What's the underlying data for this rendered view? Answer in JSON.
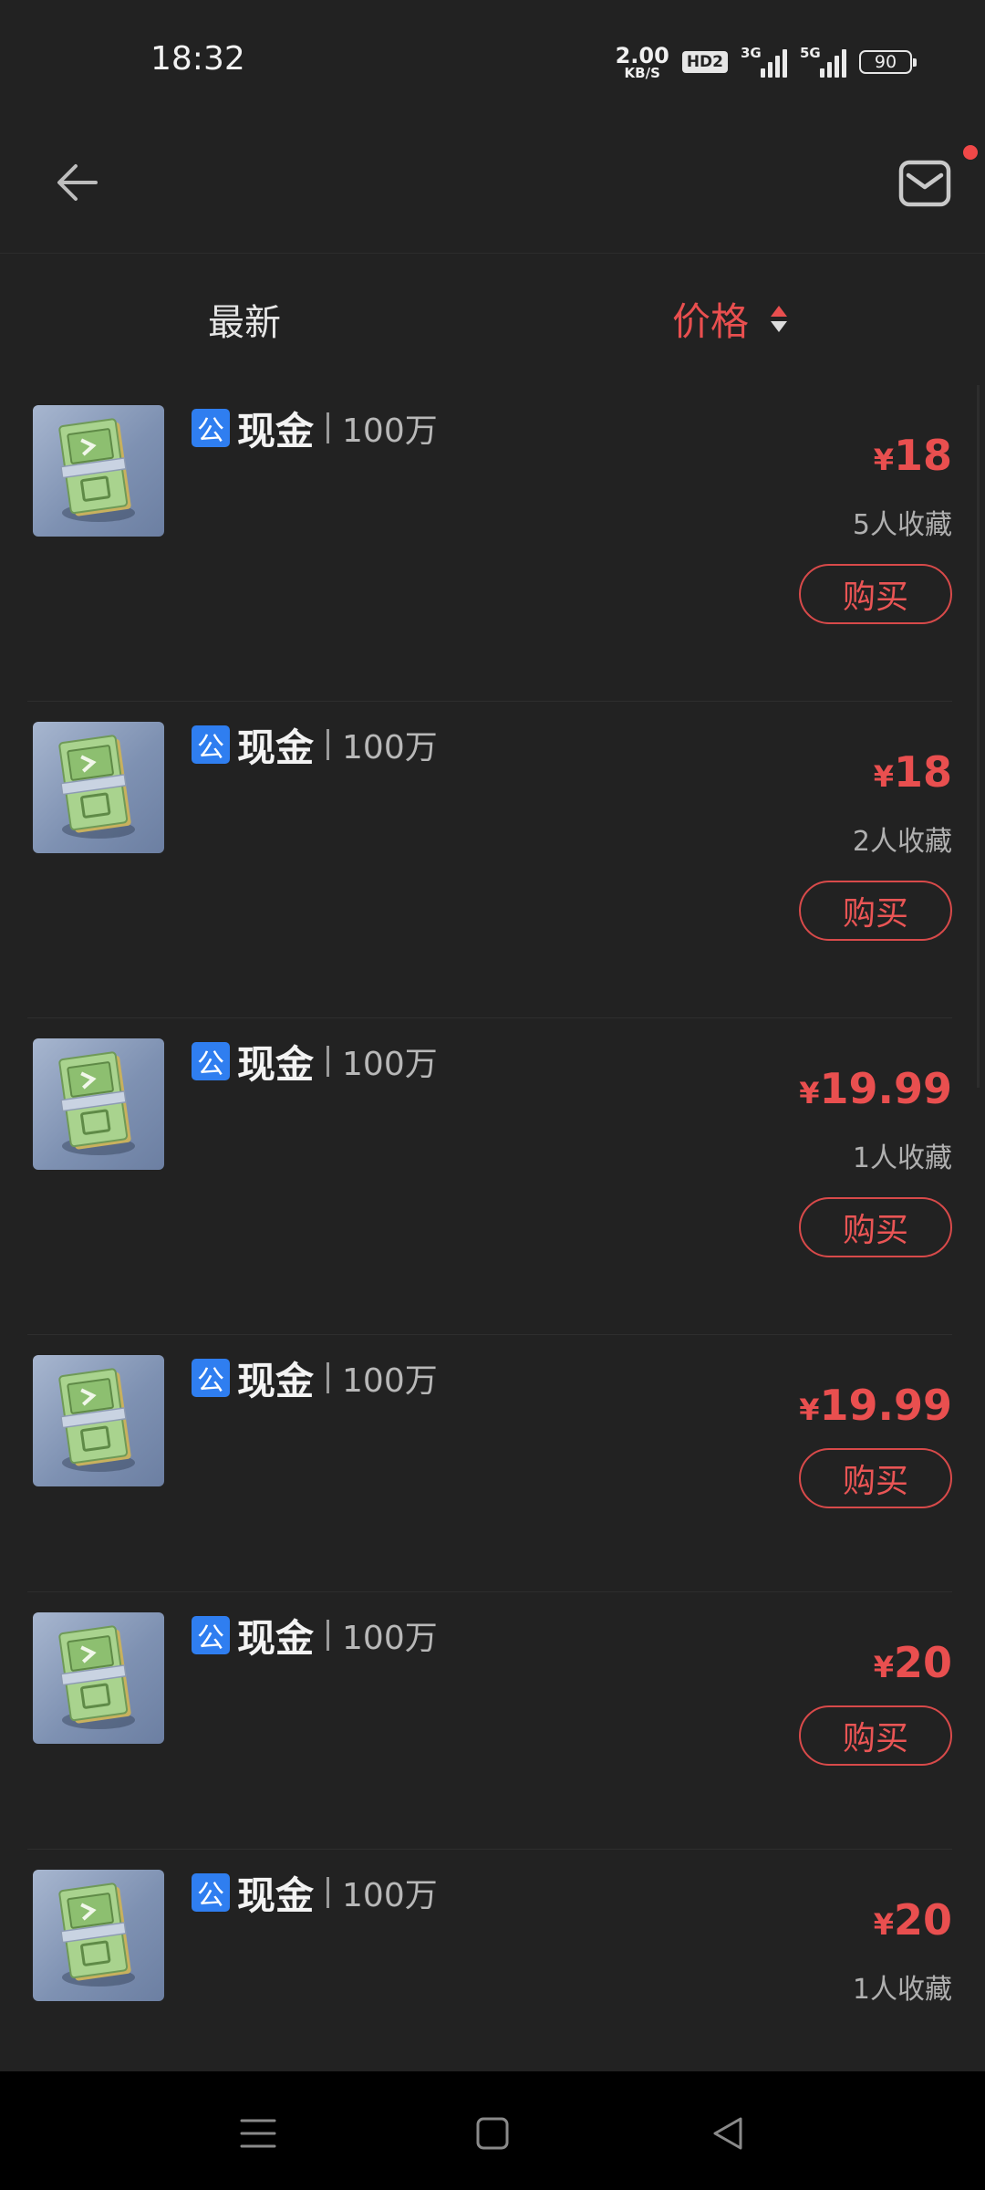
{
  "status_bar": {
    "time": "18:32",
    "net_speed_value": "2.00",
    "net_speed_unit": "KB/S",
    "hd_label": "HD2",
    "sim1_label": "3G",
    "sim2_label": "5G",
    "battery": "90"
  },
  "header": {
    "back_icon": "arrow-left-icon",
    "mail_icon": "mail-icon",
    "has_notification": true
  },
  "sort": {
    "latest_label": "最新",
    "price_label": "价格"
  },
  "colors": {
    "accent": "#e94f4f",
    "badge_blue": "#2f7ef0",
    "background": "#222222"
  },
  "items": [
    {
      "badge": "公",
      "name": "现金",
      "amount": "100万",
      "currency": "¥",
      "price": "18",
      "favorites": "5人收藏",
      "buy_label": "购买"
    },
    {
      "badge": "公",
      "name": "现金",
      "amount": "100万",
      "currency": "¥",
      "price": "18",
      "favorites": "2人收藏",
      "buy_label": "购买"
    },
    {
      "badge": "公",
      "name": "现金",
      "amount": "100万",
      "currency": "¥",
      "price": "19.99",
      "favorites": "1人收藏",
      "buy_label": "购买"
    },
    {
      "badge": "公",
      "name": "现金",
      "amount": "100万",
      "currency": "¥",
      "price": "19.99",
      "favorites": "",
      "buy_label": "购买"
    },
    {
      "badge": "公",
      "name": "现金",
      "amount": "100万",
      "currency": "¥",
      "price": "20",
      "favorites": "",
      "buy_label": "购买"
    },
    {
      "badge": "公",
      "name": "现金",
      "amount": "100万",
      "currency": "¥",
      "price": "20",
      "favorites": "1人收藏",
      "buy_label": ""
    }
  ]
}
